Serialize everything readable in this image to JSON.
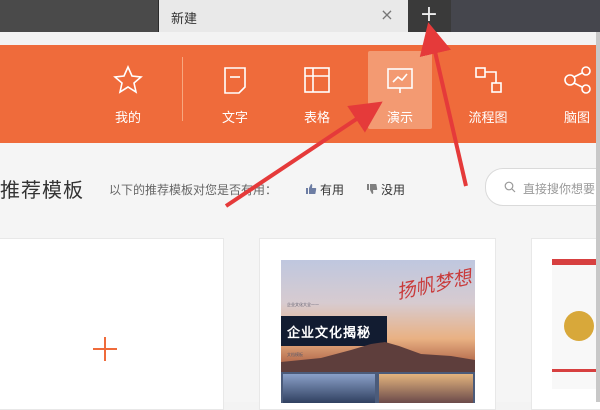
{
  "browser": {
    "tab_label": "新建",
    "close_glyph": "×",
    "new_tab_glyph": "+"
  },
  "toolbar": {
    "items": [
      {
        "label": "我的",
        "icon": "star-icon"
      },
      {
        "label": "文字",
        "icon": "document-icon"
      },
      {
        "label": "表格",
        "icon": "table-icon"
      },
      {
        "label": "演示",
        "icon": "presentation-icon"
      },
      {
        "label": "流程图",
        "icon": "flowchart-icon"
      },
      {
        "label": "脑图",
        "icon": "mindmap-icon"
      }
    ],
    "active_index": 3,
    "accent_color": "#ef6b3b"
  },
  "main": {
    "section_title": "推荐模板",
    "hint": "以下的推荐模板对您是否有用：",
    "useful_label": "有用",
    "useless_label": "没用",
    "search_placeholder": "直接搜你想要",
    "blank_card_glyph": "+",
    "template_title": "企业文化揭秘",
    "template_small_1": "企业文化大全——",
    "template_small_2": "文档模板",
    "template_calligraphy": "扬帆梦想"
  }
}
